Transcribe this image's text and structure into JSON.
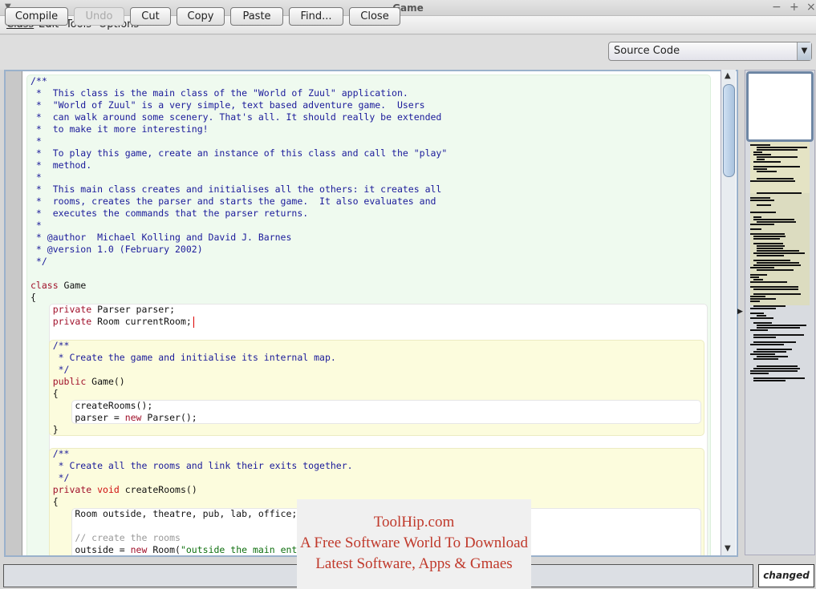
{
  "window": {
    "title": "Game",
    "controls": [
      "−",
      "+",
      "×"
    ]
  },
  "menu": [
    {
      "label": "Class"
    },
    {
      "label": "Edit"
    },
    {
      "label": "Tools"
    },
    {
      "label": "Options"
    }
  ],
  "toolbar": {
    "buttons": [
      {
        "label": "Compile",
        "enabled": true
      },
      {
        "label": "Undo",
        "enabled": false
      },
      {
        "label": "Cut",
        "enabled": true
      },
      {
        "label": "Copy",
        "enabled": true
      },
      {
        "label": "Paste",
        "enabled": true
      },
      {
        "label": "Find...",
        "enabled": true
      },
      {
        "label": "Close",
        "enabled": true
      }
    ],
    "view_select": "Source Code"
  },
  "code_lines": [
    [
      [
        "cm",
        "/**"
      ]
    ],
    [
      [
        "cm",
        " *  This class is the main class of the \"World of Zuul\" application."
      ]
    ],
    [
      [
        "cm",
        " *  \"World of Zuul\" is a very simple, text based adventure game.  Users"
      ]
    ],
    [
      [
        "cm",
        " *  can walk around some scenery. That's all. It should really be extended"
      ]
    ],
    [
      [
        "cm",
        " *  to make it more interesting!"
      ]
    ],
    [
      [
        "cm",
        " *"
      ]
    ],
    [
      [
        "cm",
        " *  To play this game, create an instance of this class and call the \"play\""
      ]
    ],
    [
      [
        "cm",
        " *  method."
      ]
    ],
    [
      [
        "cm",
        " *"
      ]
    ],
    [
      [
        "cm",
        " *  This main class creates and initialises all the others: it creates all"
      ]
    ],
    [
      [
        "cm",
        " *  rooms, creates the parser and starts the game.  It also evaluates and"
      ]
    ],
    [
      [
        "cm",
        " *  executes the commands that the parser returns."
      ]
    ],
    [
      [
        "cm",
        " *"
      ]
    ],
    [
      [
        "cm",
        " * @author  Michael Kolling and David J. Barnes"
      ]
    ],
    [
      [
        "cm",
        " * @version 1.0 (February 2002)"
      ]
    ],
    [
      [
        "cm",
        " */"
      ]
    ],
    [],
    [
      [
        "kw",
        "class"
      ],
      [
        "tx",
        " Game"
      ]
    ],
    [
      [
        "tx",
        "{"
      ]
    ],
    [
      [
        "tx",
        "    "
      ],
      [
        "kw",
        "private"
      ],
      [
        "tx",
        " Parser parser;"
      ]
    ],
    [
      [
        "tx",
        "    "
      ],
      [
        "kw",
        "private"
      ],
      [
        "tx",
        " Room currentRoom;"
      ]
    ],
    [],
    [
      [
        "cm",
        "    /**"
      ]
    ],
    [
      [
        "cm",
        "     * Create the game and initialise its internal map."
      ]
    ],
    [
      [
        "cm",
        "     */"
      ]
    ],
    [
      [
        "tx",
        "    "
      ],
      [
        "kw",
        "public"
      ],
      [
        "tx",
        " Game()"
      ]
    ],
    [
      [
        "tx",
        "    {"
      ]
    ],
    [
      [
        "tx",
        "        createRooms();"
      ]
    ],
    [
      [
        "tx",
        "        parser = "
      ],
      [
        "kw",
        "new"
      ],
      [
        "tx",
        " Parser();"
      ]
    ],
    [
      [
        "tx",
        "    }"
      ]
    ],
    [],
    [
      [
        "cm",
        "    /**"
      ]
    ],
    [
      [
        "cm",
        "     * Create all the rooms and link their exits together."
      ]
    ],
    [
      [
        "cm",
        "     */"
      ]
    ],
    [
      [
        "tx",
        "    "
      ],
      [
        "kw",
        "private"
      ],
      [
        "tx",
        " "
      ],
      [
        "kv",
        "void"
      ],
      [
        "tx",
        " createRooms()"
      ]
    ],
    [
      [
        "tx",
        "    {"
      ]
    ],
    [
      [
        "tx",
        "        Room outside, theatre, pub, lab, office;"
      ]
    ],
    [],
    [
      [
        "lc",
        "        // create the rooms"
      ]
    ],
    [
      [
        "tx",
        "        outside = "
      ],
      [
        "kw",
        "new"
      ],
      [
        "tx",
        " Room("
      ],
      [
        "st",
        "\"outside the main entrance of the university\""
      ],
      [
        "tx",
        ");"
      ]
    ]
  ],
  "status": {
    "message": "",
    "changed_label": "changed"
  },
  "watermark": {
    "line1": "ToolHip.com",
    "line2": "A Free Software World To Download",
    "line3": "Latest Software, Apps & Gmaes"
  }
}
